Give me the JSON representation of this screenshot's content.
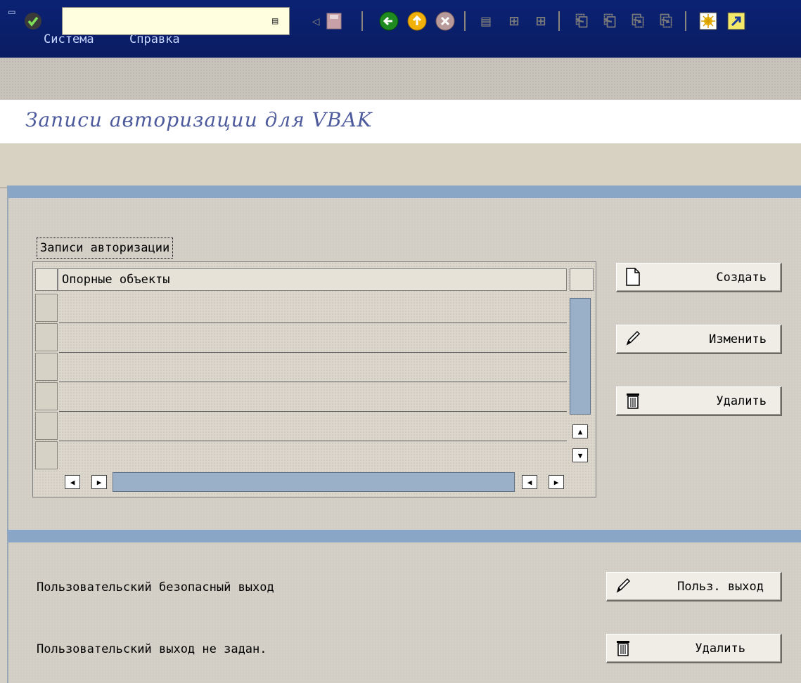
{
  "menu": {
    "items": [
      "Система",
      "Справка"
    ]
  },
  "toolbar": {
    "command_value": ""
  },
  "title": "Записи авторизации для VBAK",
  "auth_table": {
    "group_title": "Записи авторизации",
    "column_header": "Опорные объекты",
    "rows": [
      "",
      "",
      "",
      "",
      "",
      ""
    ]
  },
  "buttons": {
    "create": "Создать",
    "change": "Изменить",
    "delete": "Удалить"
  },
  "user_exit": {
    "label": "Пользовательский безопасный выход",
    "button": "Польз. выход",
    "status": "Пользовательский выход не задан.",
    "delete_button": "Удалить"
  },
  "icons": {
    "ok": "check-icon",
    "back": "green-left-arrow-icon",
    "exit": "yellow-up-arrow-icon",
    "cancel": "red-cancel-icon",
    "print": "printer-icon",
    "find": "binoculars-icon",
    "find_next": "binoculars-next-icon",
    "first_page": "first-page-icon",
    "prev_page": "prev-page-icon",
    "next_page": "next-page-icon",
    "last_page": "last-page-icon",
    "new_session": "new-session-icon",
    "shortcut": "shortcut-icon",
    "create": "blank-document-icon",
    "change": "pencil-icon",
    "delete": "trash-icon"
  },
  "colors": {
    "menubar": "#0a1f6b",
    "title": "#4d5a9c",
    "frame_header": "#8aa6c6"
  }
}
